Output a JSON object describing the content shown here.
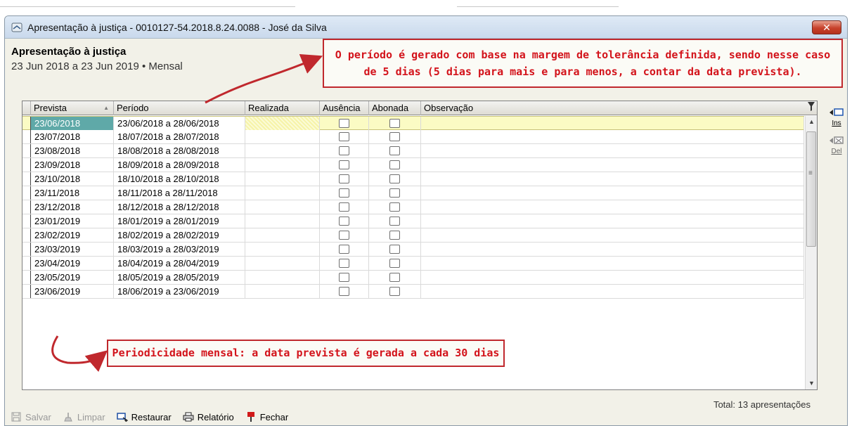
{
  "window": {
    "title": "Apresentação à justiça - 0010127-54.2018.8.24.0088 - José da Silva",
    "close_label": "✕"
  },
  "header": {
    "title": "Apresentação à justiça",
    "subtitle": "23 Jun 2018 a 23 Jun 2019 • Mensal"
  },
  "callouts": {
    "top_line1": "O período é gerado com base na margem de tolerância definida, sendo nesse caso",
    "top_line2": "de 5 dias (5 dias para mais e para menos, a contar da data prevista).",
    "bottom": "Periodicidade mensal: a data prevista é gerada a cada 30 dias"
  },
  "grid": {
    "columns": [
      "Prevista",
      "Período",
      "Realizada",
      "Ausência",
      "Abonada",
      "Observação"
    ],
    "sort_column": "Prevista",
    "rows": [
      {
        "prevista": "23/06/2018",
        "periodo": "23/06/2018 a 28/06/2018",
        "realizada": "",
        "ausencia": false,
        "abonada": false,
        "observacao": "",
        "selected": true
      },
      {
        "prevista": "23/07/2018",
        "periodo": "18/07/2018 a 28/07/2018",
        "realizada": "",
        "ausencia": false,
        "abonada": false,
        "observacao": ""
      },
      {
        "prevista": "23/08/2018",
        "periodo": "18/08/2018 a 28/08/2018",
        "realizada": "",
        "ausencia": false,
        "abonada": false,
        "observacao": ""
      },
      {
        "prevista": "23/09/2018",
        "periodo": "18/09/2018 a 28/09/2018",
        "realizada": "",
        "ausencia": false,
        "abonada": false,
        "observacao": ""
      },
      {
        "prevista": "23/10/2018",
        "periodo": "18/10/2018 a 28/10/2018",
        "realizada": "",
        "ausencia": false,
        "abonada": false,
        "observacao": ""
      },
      {
        "prevista": "23/11/2018",
        "periodo": "18/11/2018 a 28/11/2018",
        "realizada": "",
        "ausencia": false,
        "abonada": false,
        "observacao": ""
      },
      {
        "prevista": "23/12/2018",
        "periodo": "18/12/2018 a 28/12/2018",
        "realizada": "",
        "ausencia": false,
        "abonada": false,
        "observacao": ""
      },
      {
        "prevista": "23/01/2019",
        "periodo": "18/01/2019 a 28/01/2019",
        "realizada": "",
        "ausencia": false,
        "abonada": false,
        "observacao": ""
      },
      {
        "prevista": "23/02/2019",
        "periodo": "18/02/2019 a 28/02/2019",
        "realizada": "",
        "ausencia": false,
        "abonada": false,
        "observacao": ""
      },
      {
        "prevista": "23/03/2019",
        "periodo": "18/03/2019 a 28/03/2019",
        "realizada": "",
        "ausencia": false,
        "abonada": false,
        "observacao": ""
      },
      {
        "prevista": "23/04/2019",
        "periodo": "18/04/2019 a 28/04/2019",
        "realizada": "",
        "ausencia": false,
        "abonada": false,
        "observacao": ""
      },
      {
        "prevista": "23/05/2019",
        "periodo": "18/05/2019 a 28/05/2019",
        "realizada": "",
        "ausencia": false,
        "abonada": false,
        "observacao": ""
      },
      {
        "prevista": "23/06/2019",
        "periodo": "18/06/2019 a 23/06/2019",
        "realizada": "",
        "ausencia": false,
        "abonada": false,
        "observacao": ""
      }
    ]
  },
  "side_actions": {
    "insert_label": "Ins",
    "delete_label": "Del"
  },
  "footer": {
    "total": "Total: 13 apresentações"
  },
  "toolbar": {
    "save_label": "Salvar",
    "clear_label": "Limpar",
    "restore_label": "Restaurar",
    "report_label": "Relatório",
    "close_label": "Fechar"
  },
  "colors": {
    "callout_red": "#d3131b",
    "selected_row": "#fbfbc4",
    "selected_cell": "#5fa9a8"
  }
}
